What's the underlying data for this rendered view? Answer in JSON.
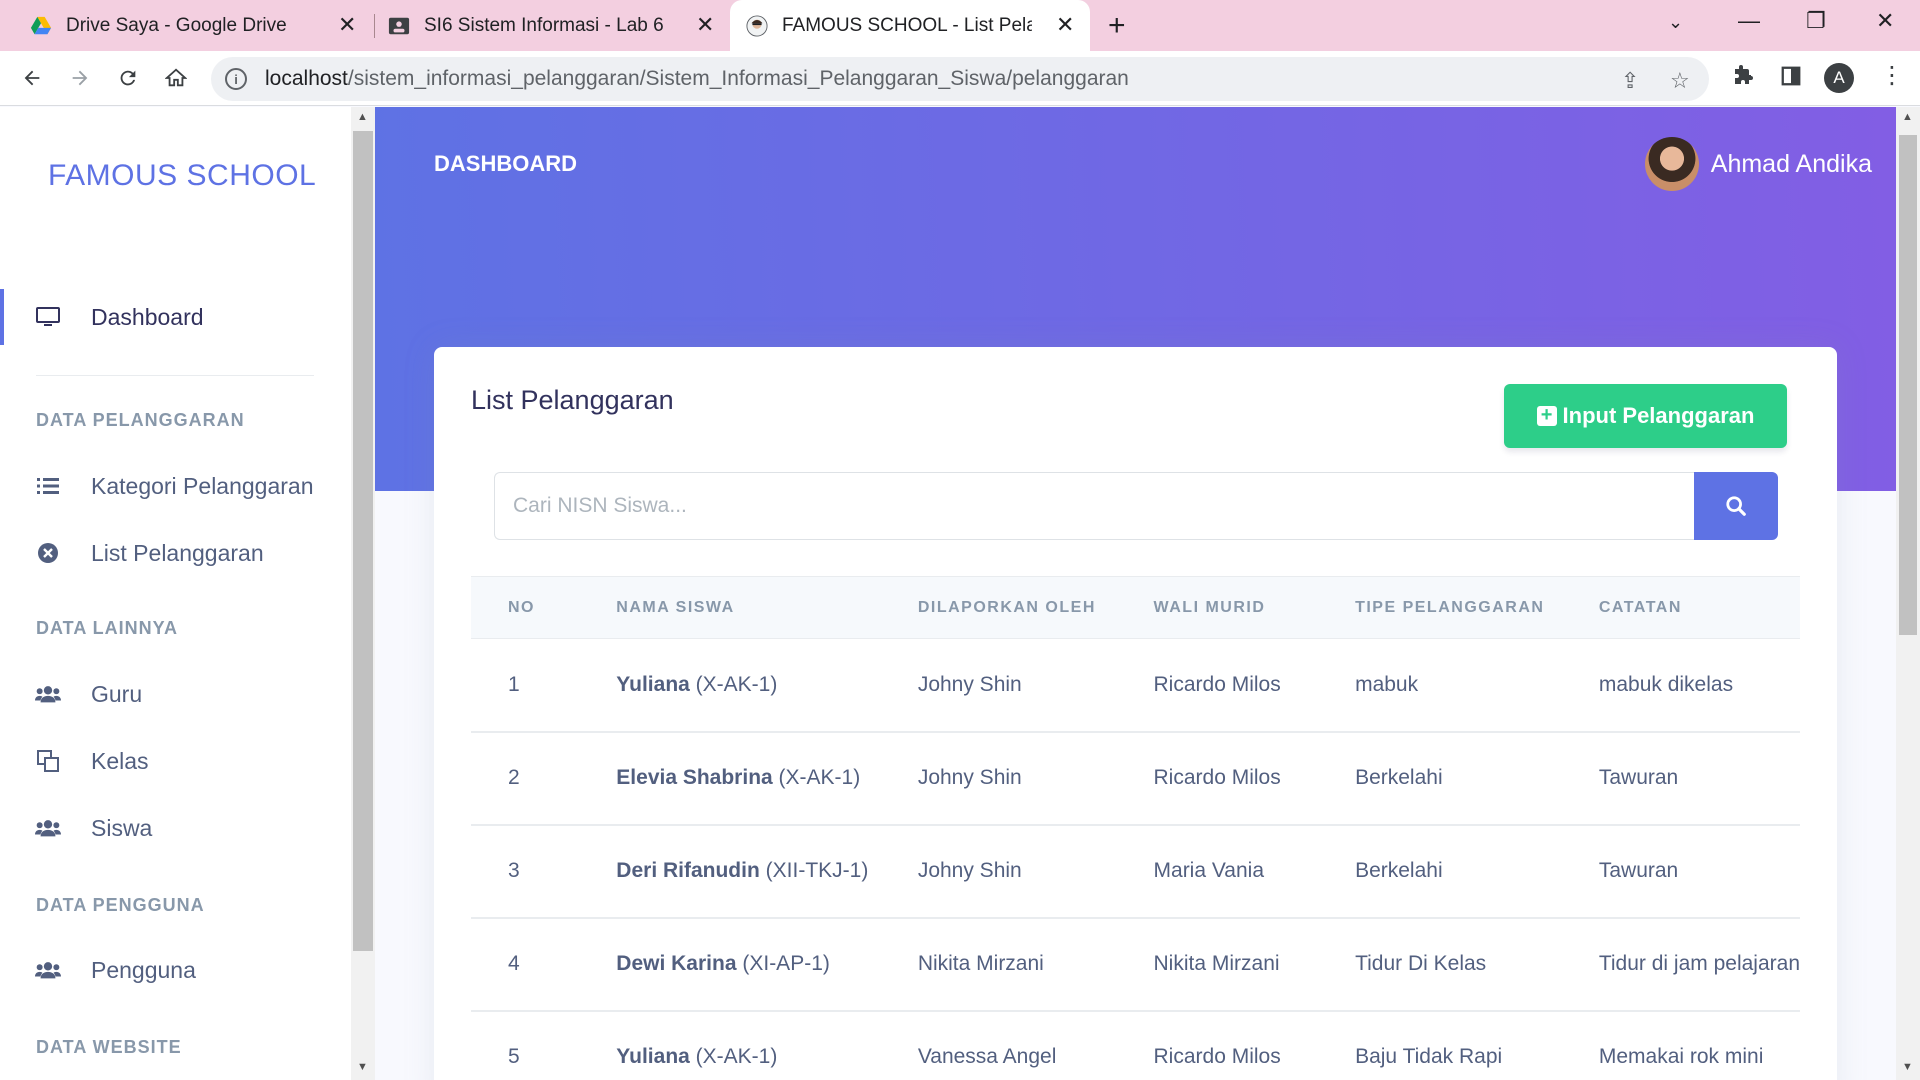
{
  "browser": {
    "tabs": [
      {
        "title": "Drive Saya - Google Drive",
        "icon": "google-drive-icon"
      },
      {
        "title": "SI6 Sistem Informasi - Lab 6",
        "icon": "classroom-icon"
      },
      {
        "title": "FAMOUS SCHOOL - List Pelangg",
        "icon": "site-favicon-icon"
      }
    ],
    "url_host": "localhost",
    "url_path": "/sistem_informasi_pelanggaran/Sistem_Informasi_Pelanggaran_Siswa/pelanggaran",
    "profile_initial": "A"
  },
  "sidebar": {
    "brand": "FAMOUS SCHOOL",
    "dashboard": "Dashboard",
    "sections": [
      {
        "heading": "DATA PELANGGARAN",
        "items": [
          "Kategori Pelanggaran",
          "List Pelanggaran"
        ]
      },
      {
        "heading": "DATA LAINNYA",
        "items": [
          "Guru",
          "Kelas",
          "Siswa"
        ]
      },
      {
        "heading": "DATA PENGGUNA",
        "items": [
          "Pengguna"
        ]
      },
      {
        "heading": "DATA WEBSITE",
        "items": []
      }
    ]
  },
  "header": {
    "title": "DASHBOARD",
    "user_name": "Ahmad Andika"
  },
  "card": {
    "title": "List Pelanggaran",
    "input_button": "Input Pelanggaran",
    "search_placeholder": "Cari NISN Siswa..."
  },
  "table": {
    "columns": [
      "NO",
      "NAMA SISWA",
      "DILAPORKAN OLEH",
      "WALI MURID",
      "TIPE PELANGGARAN",
      "CATATAN"
    ],
    "rows": [
      {
        "no": "1",
        "name": "Yuliana",
        "class": "(X-AK-1)",
        "reporter": "Johny Shin",
        "guardian": "Ricardo Milos",
        "type": "mabuk",
        "note": "mabuk dikelas"
      },
      {
        "no": "2",
        "name": "Elevia Shabrina",
        "class": "(X-AK-1)",
        "reporter": "Johny Shin",
        "guardian": "Ricardo Milos",
        "type": "Berkelahi",
        "note": "Tawuran"
      },
      {
        "no": "3",
        "name": "Deri Rifanudin",
        "class": "(XII-TKJ-1)",
        "reporter": "Johny Shin",
        "guardian": "Maria Vania",
        "type": "Berkelahi",
        "note": "Tawuran"
      },
      {
        "no": "4",
        "name": "Dewi Karina",
        "class": "(XI-AP-1)",
        "reporter": "Nikita Mirzani",
        "guardian": "Nikita Mirzani",
        "type": "Tidur Di Kelas",
        "note": "Tidur di jam pelajaran"
      },
      {
        "no": "5",
        "name": "Yuliana",
        "class": "(X-AK-1)",
        "reporter": "Vanessa Angel",
        "guardian": "Ricardo Milos",
        "type": "Baju Tidak Rapi",
        "note": "Memakai rok mini"
      }
    ]
  },
  "colors": {
    "primary": "#5e72e4",
    "gradient_end": "#825ee4",
    "success": "#2dce89",
    "tab_bar": "#f3cfe0"
  }
}
